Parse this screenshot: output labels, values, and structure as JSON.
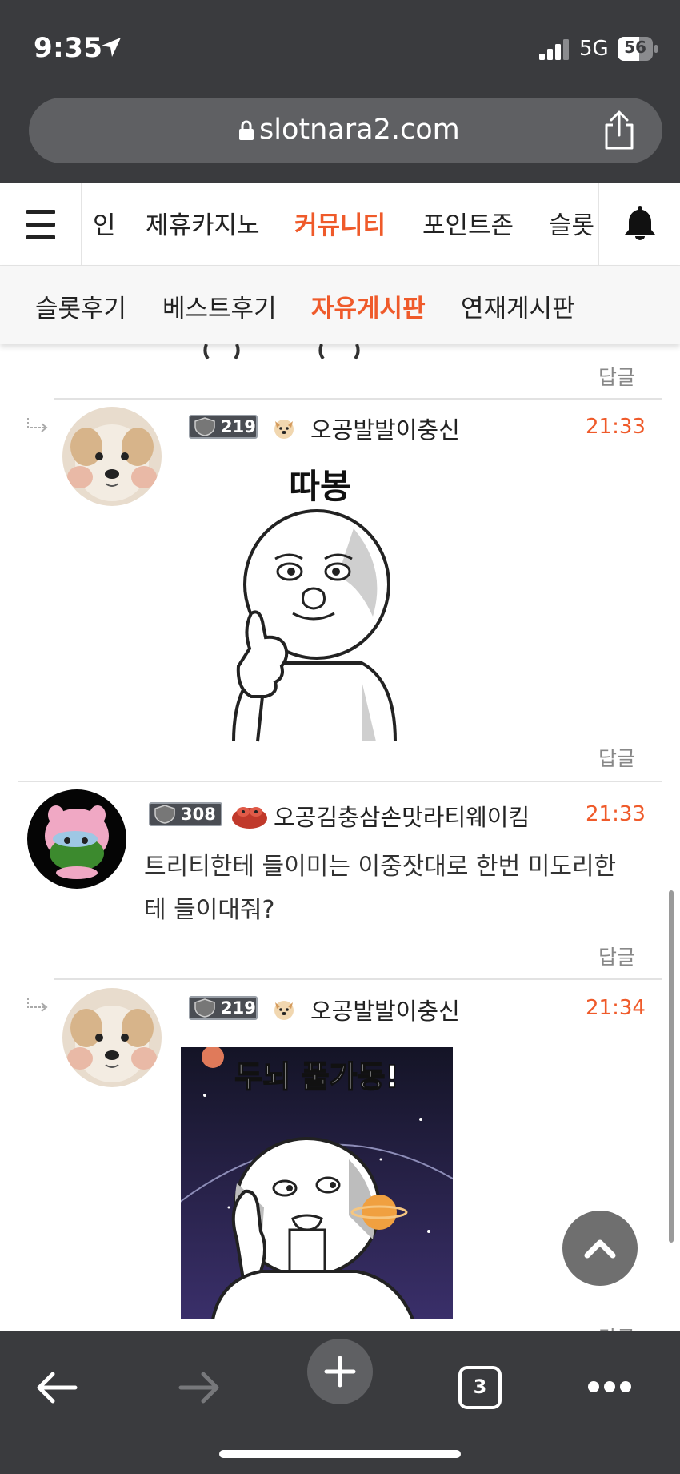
{
  "status_bar": {
    "time": "9:35",
    "network": "5G",
    "battery": "56"
  },
  "browser": {
    "url": "slotnara2.com",
    "tab_count": "3"
  },
  "site_nav": {
    "items": [
      {
        "label": "인"
      },
      {
        "label": "제휴카지노"
      },
      {
        "label": "커뮤니티",
        "active": true
      },
      {
        "label": "포인트존"
      },
      {
        "label": "슬롯"
      }
    ]
  },
  "sub_nav": {
    "items": [
      {
        "label": "슬롯후기"
      },
      {
        "label": "베스트후기"
      },
      {
        "label": "자유게시판",
        "active": true
      },
      {
        "label": "연재게시판"
      }
    ]
  },
  "reply_label": "답글",
  "comments": [
    {
      "level": "219",
      "nickname": "오공발발이충신",
      "time": "21:33",
      "sticker_caption": "따봉",
      "is_reply": true
    },
    {
      "level": "308",
      "nickname": "오공김충삼손맛라티웨이킴",
      "time": "21:33",
      "text_line1": "트리티한테 들이미는 이중잣대로 한번 미도리한",
      "text_line2": "테 들이대줘?",
      "is_reply": false
    },
    {
      "level": "219",
      "nickname": "오공발발이충신",
      "time": "21:34",
      "sticker_caption": "두뇌 풀가동!",
      "is_reply": true
    }
  ],
  "colors": {
    "accent": "#ef5a2a",
    "chrome": "#3a3b3e"
  }
}
